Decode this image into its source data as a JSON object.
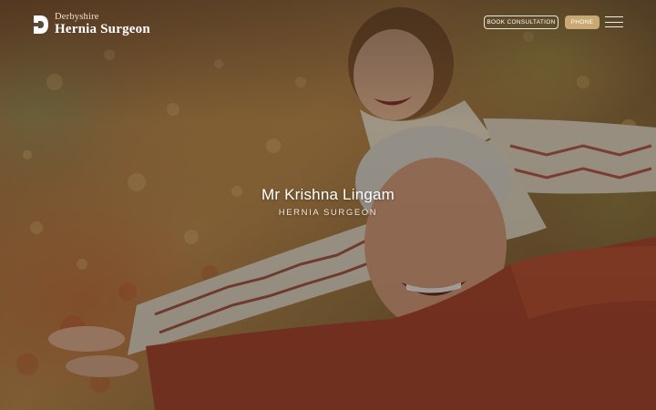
{
  "brand": {
    "line1": "Derbyshire",
    "line2": "Hernia Surgeon",
    "logo_icon": "d-monogram-icon"
  },
  "header": {
    "book_label": "BOOK CONSULTATION",
    "phone_label": "PHONE",
    "menu_icon": "hamburger-menu-icon"
  },
  "hero": {
    "title": "Mr Krishna Lingam",
    "subtitle": "HERNIA SURGEON",
    "image_subject": "hero-photo-grandfather-and-girl"
  },
  "colors": {
    "accent": "#c9a873",
    "text": "#ffffff"
  }
}
